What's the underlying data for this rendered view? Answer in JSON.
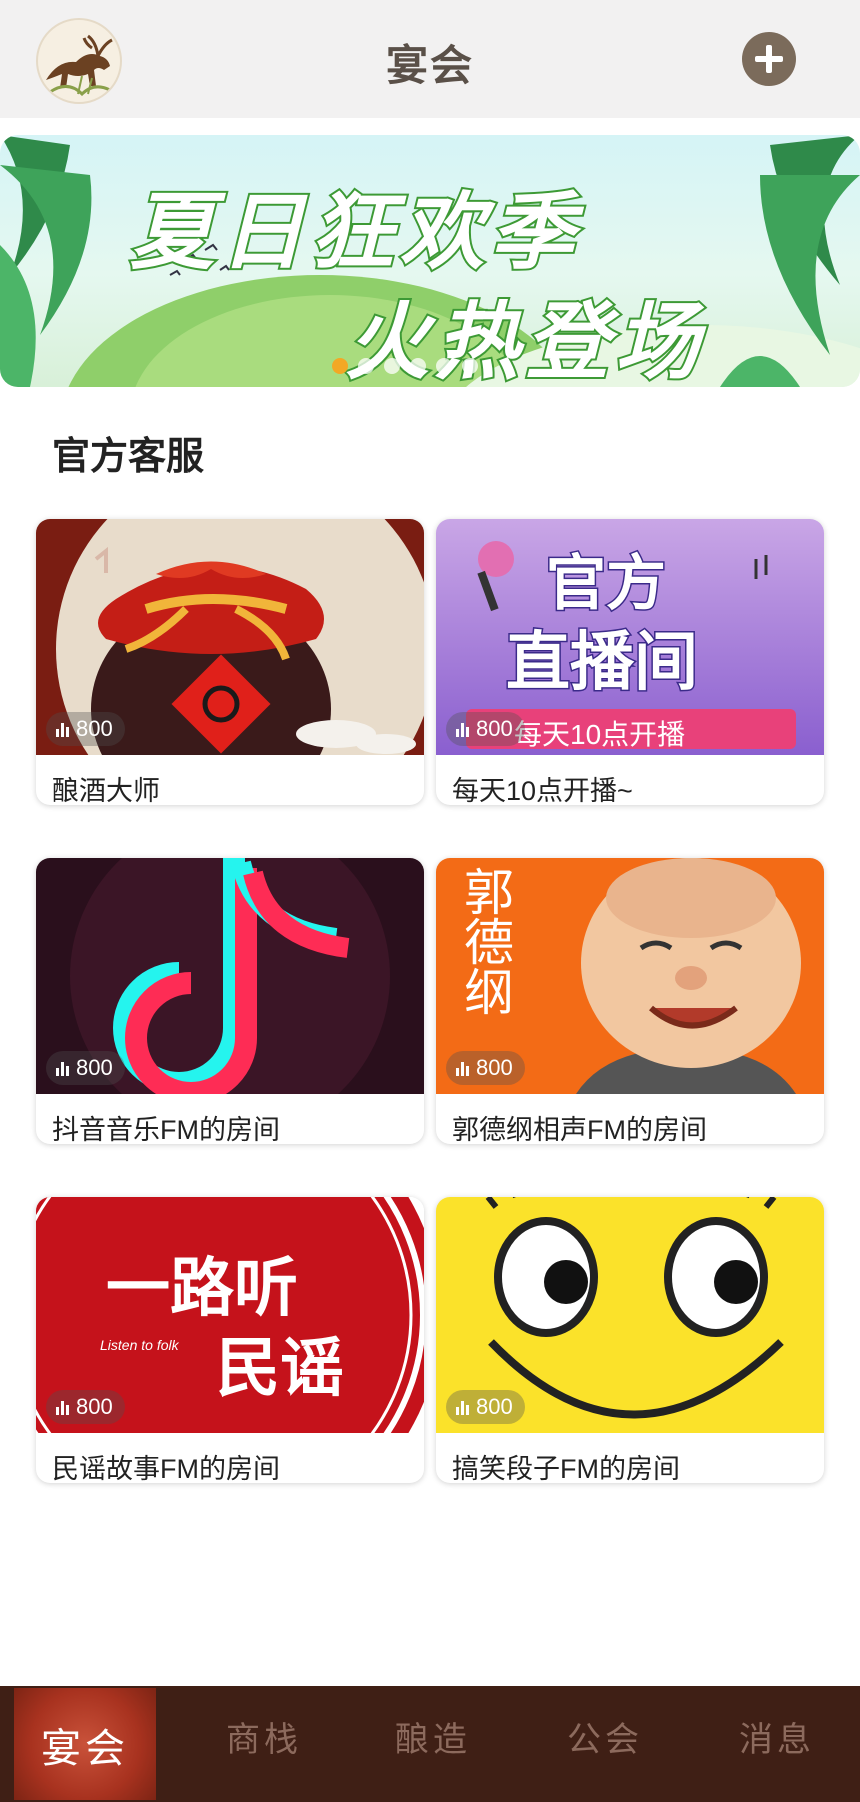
{
  "header": {
    "title": "宴会",
    "avatar_icon": "deer-logo-icon",
    "add_icon": "plus-icon"
  },
  "banner": {
    "line1": "夏日狂欢季",
    "line2": "火热登场",
    "slide_count": 6,
    "active_slide": 1
  },
  "section": {
    "title": "官方客服"
  },
  "rooms": [
    {
      "name": "酿酒大师",
      "listeners": "800",
      "thumb": "wine-jar-art"
    },
    {
      "name": "每天10点开播~",
      "listeners": "800",
      "thumb": "official-live-poster",
      "poster_line1": "官方",
      "poster_line2": "直播间",
      "poster_ribbon": "每天10点开播"
    },
    {
      "name": "抖音音乐FM的房间",
      "listeners": "800",
      "thumb": "tiktok-note-logo"
    },
    {
      "name": "郭德纲相声FM的房间",
      "listeners": "800",
      "thumb": "caricature-portrait",
      "poster_text": "郭德纲"
    },
    {
      "name": "民谣故事FM的房间",
      "listeners": "800",
      "thumb": "folk-calligraphy",
      "poster_line1": "一路听",
      "poster_line2": "民谣",
      "poster_small": "Listen to folk"
    },
    {
      "name": "搞笑段子FM的房间",
      "listeners": "800",
      "thumb": "smiley-face"
    }
  ],
  "bottom_nav": {
    "items": [
      "宴会",
      "商栈",
      "酿造",
      "公会",
      "消息"
    ],
    "active_index": 0
  },
  "colors": {
    "header_bg": "#f2f1f1",
    "nav_bg": "#3f1f15",
    "nav_active": "#a8321f",
    "badge_active_dot": "#f3a825"
  }
}
